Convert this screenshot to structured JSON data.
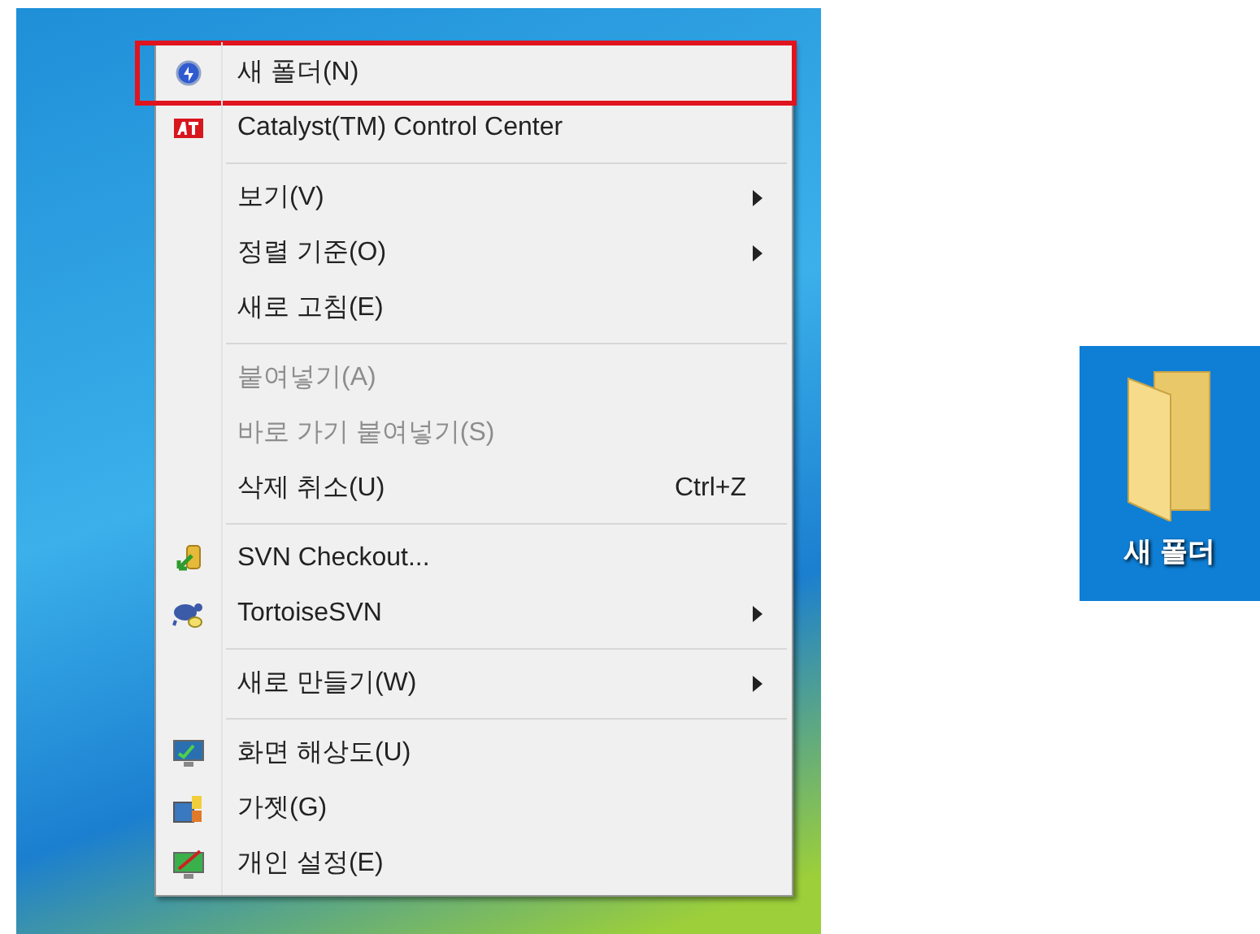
{
  "context_menu": {
    "groups": [
      {
        "items": [
          {
            "label": "새 폴더(N)",
            "icon": true,
            "highlighted": true,
            "disabled": false,
            "submenu": false
          },
          {
            "label": "Catalyst(TM) Control Center",
            "icon": true,
            "highlighted": false,
            "disabled": false,
            "submenu": false
          }
        ]
      },
      {
        "items": [
          {
            "label": "보기(V)",
            "icon": false,
            "highlighted": false,
            "disabled": false,
            "submenu": true
          },
          {
            "label": "정렬 기준(O)",
            "icon": false,
            "highlighted": false,
            "disabled": false,
            "submenu": true
          },
          {
            "label": "새로 고침(E)",
            "icon": false,
            "highlighted": false,
            "disabled": false,
            "submenu": false
          }
        ]
      },
      {
        "items": [
          {
            "label": "붙여넣기(A)",
            "icon": false,
            "highlighted": false,
            "disabled": true,
            "submenu": false
          },
          {
            "label": "바로 가기 붙여넣기(S)",
            "icon": false,
            "highlighted": false,
            "disabled": true,
            "submenu": false
          },
          {
            "label": "삭제 취소(U)",
            "shortcut": "Ctrl+Z",
            "icon": false,
            "highlighted": false,
            "disabled": false,
            "submenu": false
          }
        ]
      },
      {
        "items": [
          {
            "label": "SVN Checkout...",
            "icon": true,
            "highlighted": false,
            "disabled": false,
            "submenu": false
          },
          {
            "label": "TortoiseSVN",
            "icon": true,
            "highlighted": false,
            "disabled": false,
            "submenu": true
          }
        ]
      },
      {
        "items": [
          {
            "label": "새로 만들기(W)",
            "icon": false,
            "highlighted": false,
            "disabled": false,
            "submenu": true
          }
        ]
      },
      {
        "items": [
          {
            "label": "화면 해상도(U)",
            "icon": true,
            "highlighted": false,
            "disabled": false,
            "submenu": false
          },
          {
            "label": "가젯(G)",
            "icon": true,
            "highlighted": false,
            "disabled": false,
            "submenu": false
          },
          {
            "label": "개인 설정(E)",
            "icon": true,
            "highlighted": false,
            "disabled": false,
            "submenu": false
          }
        ]
      }
    ]
  },
  "desktop_icon": {
    "label": "새 폴더"
  }
}
